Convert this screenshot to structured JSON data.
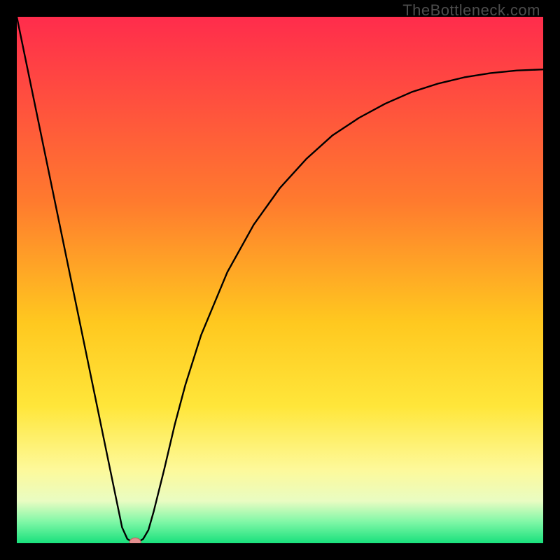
{
  "watermark": "TheBottleneck.com",
  "colors": {
    "grad_top": "#ff2c4c",
    "grad_mid1": "#ff7a2e",
    "grad_mid2": "#ffc81f",
    "grad_mid3": "#ffe63a",
    "grad_mid4": "#fdf99a",
    "grad_bottom1": "#e9fcc2",
    "grad_bottom2": "#7ef7a6",
    "grad_bottom3": "#18e07c",
    "line": "#000000",
    "dot_fill": "#e48f8f",
    "dot_stroke": "#c25c5c"
  },
  "chart_data": {
    "type": "line",
    "title": "",
    "xlabel": "",
    "ylabel": "",
    "xlim": [
      0,
      100
    ],
    "ylim": [
      0,
      100
    ],
    "series": [
      {
        "name": "bottleneck-curve",
        "x": [
          0,
          2,
          4,
          6,
          8,
          10,
          12,
          14,
          16,
          18,
          20,
          21,
          22,
          23,
          24,
          25,
          26,
          28,
          30,
          32,
          35,
          40,
          45,
          50,
          55,
          60,
          65,
          70,
          75,
          80,
          85,
          90,
          95,
          100
        ],
        "y": [
          100,
          90.3,
          80.6,
          70.9,
          61.2,
          51.5,
          41.8,
          32.1,
          22.4,
          12.7,
          3.0,
          0.8,
          0.2,
          0.2,
          0.8,
          2.5,
          6.0,
          14.0,
          22.5,
          30.0,
          39.5,
          51.5,
          60.5,
          67.5,
          73.0,
          77.5,
          80.8,
          83.5,
          85.7,
          87.3,
          88.5,
          89.3,
          89.8,
          90.0
        ]
      }
    ],
    "marker": {
      "x": 22.5,
      "y": 0.2
    }
  }
}
